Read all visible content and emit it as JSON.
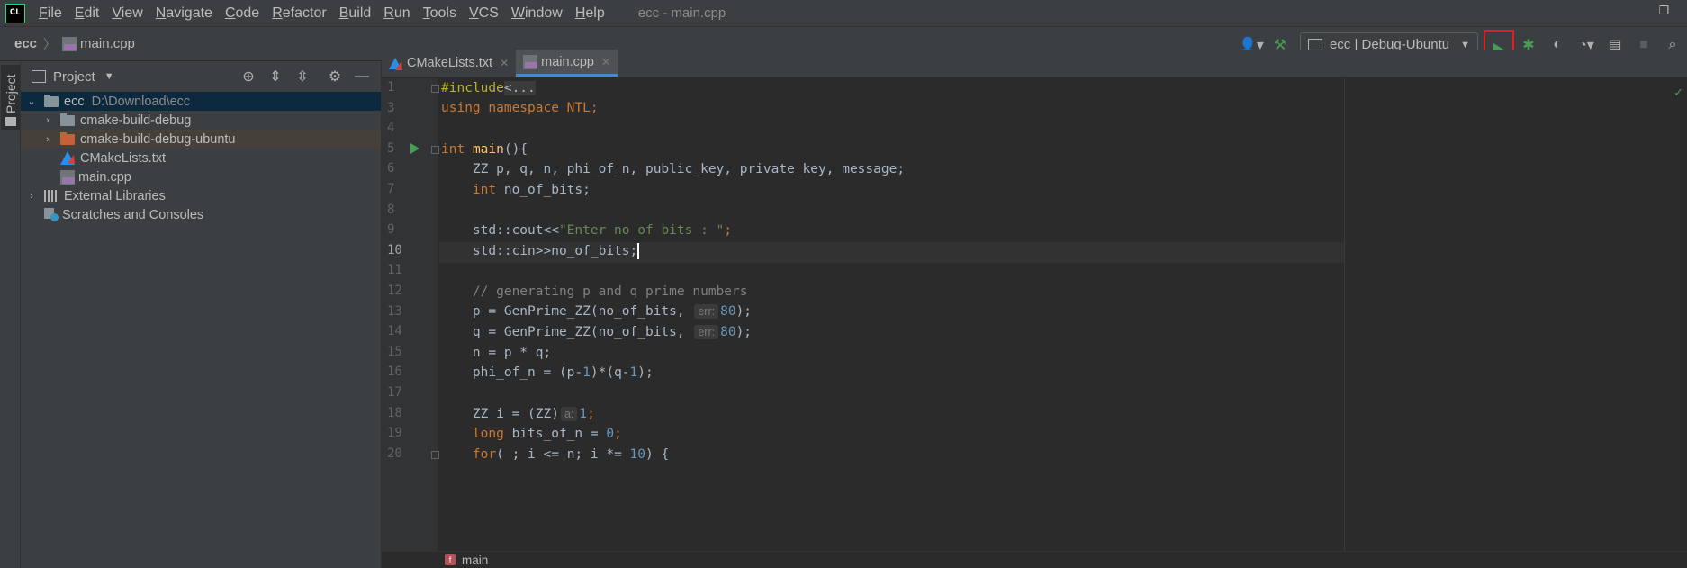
{
  "app": {
    "logo_text": "CL",
    "window_title": "ecc - main.cpp",
    "menu": [
      "File",
      "Edit",
      "View",
      "Navigate",
      "Code",
      "Refactor",
      "Build",
      "Run",
      "Tools",
      "VCS",
      "Window",
      "Help"
    ],
    "window_control": "❐"
  },
  "navbar": {
    "breadcrumb_root": "ecc",
    "breadcrumb_file": "main.cpp",
    "run_config": "ecc | Debug-Ubuntu",
    "icons": [
      "add-user-icon",
      "hammer-icon",
      "run-icon",
      "debug-icon",
      "coverage-icon",
      "profile-icon",
      "attach-icon",
      "stop-icon",
      "search-icon"
    ]
  },
  "left_strip": {
    "label": "Project"
  },
  "project_panel": {
    "title": "Project",
    "tree": [
      {
        "label": "ecc",
        "hint": "D:\\Download\\ecc"
      },
      {
        "label": "cmake-build-debug"
      },
      {
        "label": "cmake-build-debug-ubuntu"
      },
      {
        "label": "CMakeLists.txt"
      },
      {
        "label": "main.cpp"
      },
      {
        "label": "External Libraries"
      },
      {
        "label": "Scratches and Consoles"
      }
    ]
  },
  "tabs": [
    {
      "label": "CMakeLists.txt",
      "active": false
    },
    {
      "label": "main.cpp",
      "active": true
    }
  ],
  "editor": {
    "line_numbers": [
      "1",
      "3",
      "4",
      "5",
      "6",
      "7",
      "8",
      "9",
      "10",
      "11",
      "12",
      "13",
      "14",
      "15",
      "16",
      "17",
      "18",
      "19",
      "20"
    ],
    "current_line": "10",
    "lines": {
      "l1_include": "#include",
      "l1_fold": "<...",
      "l3": "using namespace NTL;",
      "l5_kw": "int",
      "l5_fn": "main",
      "l5_rest": "(){",
      "l6": "ZZ p, q, n, phi_of_n, public_key, private_key, message;",
      "l7_kw": "int",
      "l7_rest": " no_of_bits;",
      "l9_a": "std::cout<<",
      "l9_str": "\"Enter no of bits : \"",
      "l9_b": ";",
      "l10": "std::cin>>no_of_bits;",
      "l12": "// generating p and q prime numbers",
      "l13_a": "p = GenPrime_ZZ(no_of_bits,",
      "l13_hint": "err:",
      "l13_num": "80",
      "l13_b": ");",
      "l14_a": "q = GenPrime_ZZ(no_of_bits,",
      "l14_hint": "err:",
      "l14_num": "80",
      "l14_b": ");",
      "l15": "n = p * q;",
      "l16_a": "phi_of_n = (p-",
      "l16_n1": "1",
      "l16_b": ")*(q-",
      "l16_n2": "1",
      "l16_c": ");",
      "l18_a": "ZZ i = (ZZ)",
      "l18_hint": "a:",
      "l18_num": "1",
      "l18_b": ";",
      "l19_kw": "long",
      "l19_a": " bits_of_n = ",
      "l19_num": "0",
      "l19_b": ";",
      "l20_kw": "for",
      "l20_a": "( ; i <= n; i *= ",
      "l20_num": "10",
      "l20_b": ") {"
    }
  },
  "footer": {
    "badge": "f",
    "function_name": "main"
  },
  "colors": {
    "accent_tab": "#4a88c7",
    "run_green": "#499c54",
    "highlight_box": "#e02020",
    "excluded_folder": "#c7603a"
  }
}
